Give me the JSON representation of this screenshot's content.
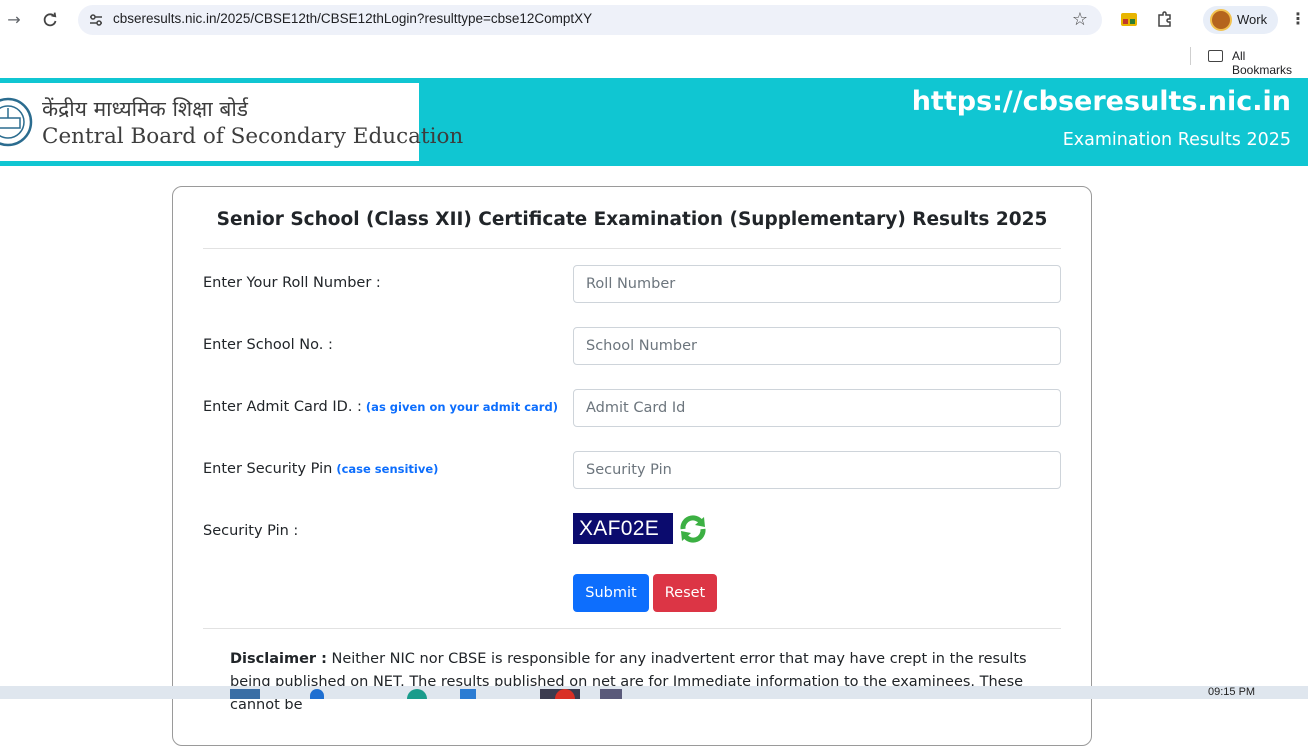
{
  "browser": {
    "url": "cbseresults.nic.in/2025/CBSE12th/CBSE12thLogin?resulttype=cbse12ComptXY",
    "profile_label": "Work",
    "bookmarks_label": "All Bookmarks",
    "icons": [
      "forward-icon",
      "reload-icon",
      "site-info-icon",
      "star-icon",
      "extension-icon",
      "puzzle-icon",
      "menu-icon",
      "folder-icon"
    ]
  },
  "header": {
    "hindi_name": "केंद्रीय माध्यमिक शिक्षा बोर्ड",
    "english_name": "Central Board of Secondary Education",
    "site_url": "https://cbseresults.nic.in",
    "site_subtitle": "Examination Results 2025",
    "band_color": "#10c6d2"
  },
  "form": {
    "title": "Senior School (Class XII) Certificate Examination (Supplementary) Results 2025",
    "roll_label": "Enter Your Roll Number :",
    "roll_placeholder": "Roll Number",
    "school_label": "Enter School No. :",
    "school_placeholder": "School Number",
    "admit_label": "Enter Admit Card ID. :",
    "admit_note": "(as given on your admit card)",
    "admit_placeholder": "Admit Card Id",
    "pin_label": "Enter Security Pin",
    "pin_note": "(case sensitive)",
    "pin_placeholder": "Security Pin",
    "captcha_label": "Security Pin :",
    "captcha_value": "XAF02E",
    "submit_label": "Submit",
    "reset_label": "Reset",
    "submit_color": "#0d6efd",
    "reset_color": "#dc3545"
  },
  "disclaimer": {
    "heading": "Disclaimer :",
    "text": " Neither NIC nor CBSE is responsible for any inadvertent error that may have crept in the results being published on NET. The results published on net are for Immediate information to the examinees. These cannot be"
  },
  "taskbar": {
    "clock": "09:15 PM"
  }
}
